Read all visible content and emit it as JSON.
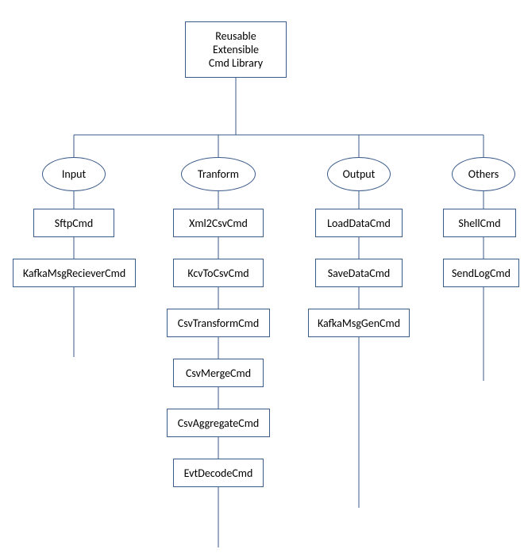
{
  "root": {
    "title_line1": "Reusable",
    "title_line2": "Extensible",
    "title_line3": "Cmd Library"
  },
  "branches": {
    "input": {
      "label": "Input",
      "items": [
        "SftpCmd",
        "KafkaMsgRecieverCmd"
      ]
    },
    "transform": {
      "label": "Tranform",
      "items": [
        "Xml2CsvCmd",
        "KcvToCsvCmd",
        "CsvTransformCmd",
        "CsvMergeCmd",
        "CsvAggregateCmd",
        "EvtDecodeCmd"
      ]
    },
    "output": {
      "label": "Output",
      "items": [
        "LoadDataCmd",
        "SaveDataCmd",
        "KafkaMsgGenCmd"
      ]
    },
    "others": {
      "label": "Others",
      "items": [
        "ShellCmd",
        "SendLogCmd"
      ]
    }
  },
  "chart_data": {
    "type": "tree",
    "title": "Reusable Extensible Cmd Library",
    "root": "Reusable Extensible Cmd Library",
    "children": [
      {
        "name": "Input",
        "children": [
          "SftpCmd",
          "KafkaMsgRecieverCmd"
        ]
      },
      {
        "name": "Tranform",
        "children": [
          "Xml2CsvCmd",
          "KcvToCsvCmd",
          "CsvTransformCmd",
          "CsvMergeCmd",
          "CsvAggregateCmd",
          "EvtDecodeCmd"
        ]
      },
      {
        "name": "Output",
        "children": [
          "LoadDataCmd",
          "SaveDataCmd",
          "KafkaMsgGenCmd"
        ]
      },
      {
        "name": "Others",
        "children": [
          "ShellCmd",
          "SendLogCmd"
        ]
      }
    ]
  }
}
